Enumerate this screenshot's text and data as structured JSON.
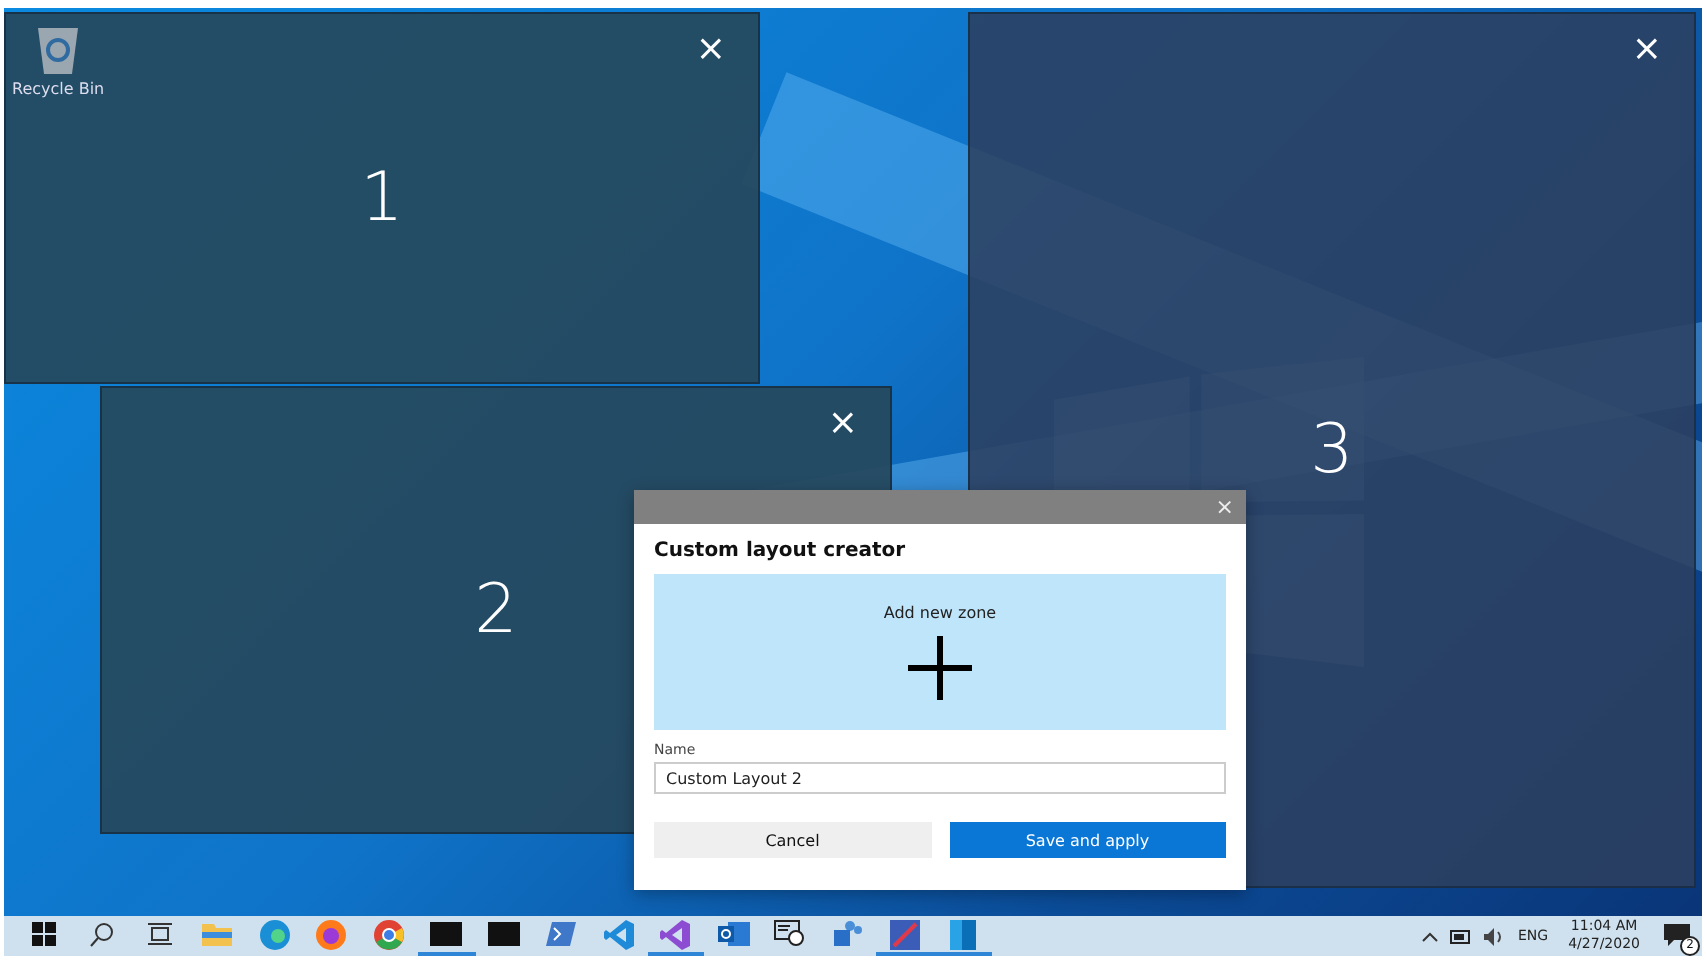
{
  "desktop": {
    "icons": [
      {
        "label": "Recycle Bin"
      }
    ]
  },
  "zones": [
    {
      "number": "1",
      "close": "×"
    },
    {
      "number": "2",
      "close": "×"
    },
    {
      "number": "3",
      "close": "×"
    }
  ],
  "dialog": {
    "close": "×",
    "title": "Custom layout creator",
    "add_zone": {
      "label": "Add new zone"
    },
    "name_label": "Name",
    "name_value": "Custom Layout 2",
    "buttons": [
      {
        "label": "Cancel",
        "kind": "secondary"
      },
      {
        "label": "Save and apply",
        "kind": "primary"
      }
    ]
  },
  "taskbar": {
    "apps": [
      {
        "kind": "start",
        "running": false
      },
      {
        "kind": "search",
        "running": false
      },
      {
        "kind": "taskview",
        "running": false
      },
      {
        "kind": "folder",
        "running": false
      },
      {
        "kind": "edge",
        "running": false
      },
      {
        "kind": "firefox",
        "running": false
      },
      {
        "kind": "chrome",
        "running": false
      },
      {
        "kind": "terminal",
        "running": true
      },
      {
        "kind": "terminal",
        "running": false
      },
      {
        "kind": "powershell",
        "running": false
      },
      {
        "kind": "vscode",
        "running": false
      },
      {
        "kind": "vs",
        "running": true
      },
      {
        "kind": "outlook",
        "running": false
      },
      {
        "kind": "remote",
        "running": false
      },
      {
        "kind": "teams",
        "running": false
      },
      {
        "kind": "paint",
        "running": true
      },
      {
        "kind": "tablet",
        "running": true
      }
    ],
    "tray": {
      "language": "ENG",
      "time": "11:04 AM",
      "date": "4/27/2020",
      "notifications": "2"
    }
  }
}
